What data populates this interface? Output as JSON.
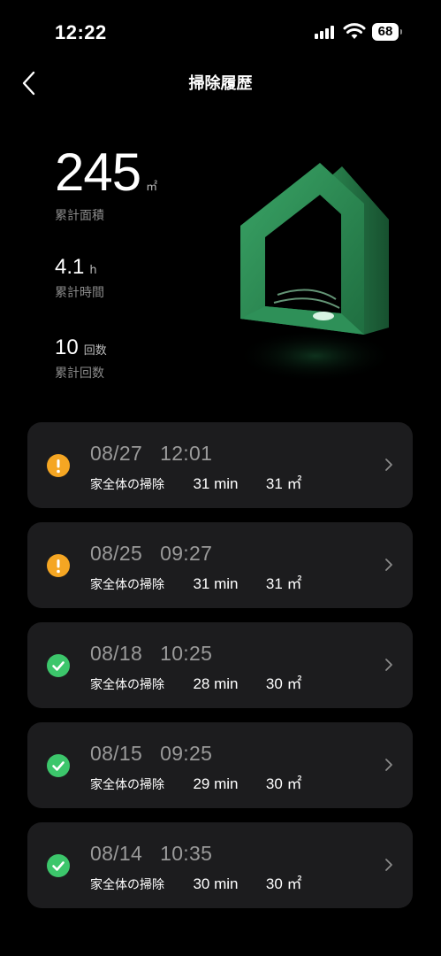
{
  "status_bar": {
    "time": "12:22",
    "battery": "68"
  },
  "header": {
    "title": "掃除履歴"
  },
  "stats": {
    "area": {
      "value": "245",
      "unit": "㎡",
      "label": "累計面積"
    },
    "time": {
      "value": "4.1",
      "unit": "h",
      "label": "累計時間"
    },
    "count": {
      "value": "10",
      "unit": "回数",
      "label": "累計回数"
    }
  },
  "history": [
    {
      "date": "08/27   12:01",
      "mode": "家全体の掃除",
      "duration": "31 min",
      "area": "31 ㎡",
      "status": "warning"
    },
    {
      "date": "08/25   09:27",
      "mode": "家全体の掃除",
      "duration": "31 min",
      "area": "31 ㎡",
      "status": "warning"
    },
    {
      "date": "08/18   10:25",
      "mode": "家全体の掃除",
      "duration": "28 min",
      "area": "30 ㎡",
      "status": "success"
    },
    {
      "date": "08/15   09:25",
      "mode": "家全体の掃除",
      "duration": "29 min",
      "area": "30 ㎡",
      "status": "success"
    },
    {
      "date": "08/14   10:35",
      "mode": "家全体の掃除",
      "duration": "30 min",
      "area": "30 ㎡",
      "status": "success"
    }
  ],
  "colors": {
    "warning": "#f5a623",
    "success": "#3cc66b",
    "card_bg": "#1c1c1e",
    "house_green": "#2f8f55"
  }
}
